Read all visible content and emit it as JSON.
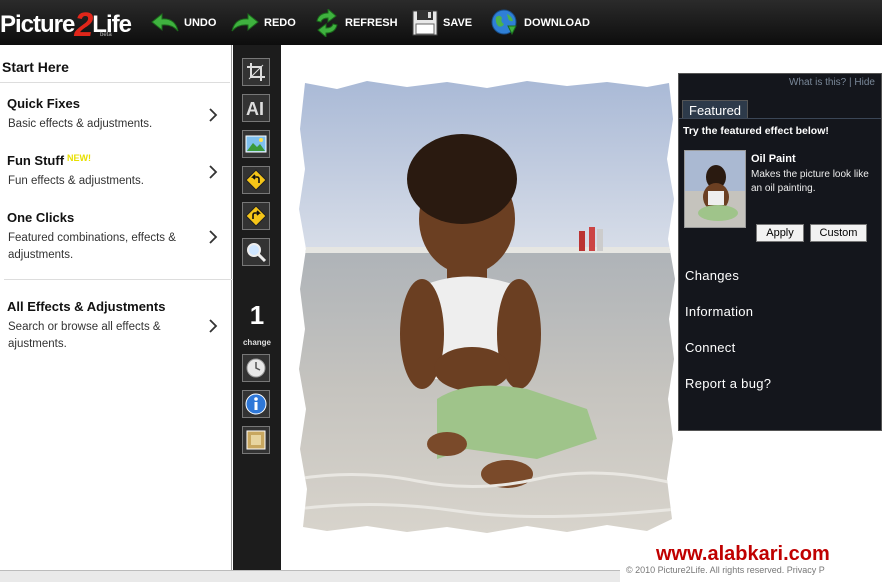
{
  "app": {
    "logo_text_a": "Picture",
    "logo_text_b": "2",
    "logo_text_c": "Life",
    "logo_beta": "beta"
  },
  "toolbar": {
    "undo": "UNDO",
    "redo": "REDO",
    "refresh": "REFRESH",
    "save": "SAVE",
    "download": "DOWNLOAD"
  },
  "sidebar": {
    "title": "Start Here",
    "items": [
      {
        "title": "Quick Fixes",
        "desc": "Basic effects & adjustments."
      },
      {
        "title": "Fun Stuff",
        "badge": "NEW!",
        "desc": "Fun effects & adjustments."
      },
      {
        "title": "One Clicks",
        "desc": "Featured combinations, effects & adjustments."
      },
      {
        "title": "All Effects & Adjustments",
        "desc": "Search or browse all effects & ajustments."
      }
    ]
  },
  "tools": {
    "icons": [
      "crop-icon",
      "text-icon",
      "image-icon",
      "rotate-left-icon",
      "rotate-right-icon",
      "zoom-icon",
      "history-clock-icon",
      "info-icon",
      "frame-icon"
    ],
    "change_count": "1",
    "change_label": "change"
  },
  "right_panel": {
    "what_is_this": "What is this?",
    "separator": "|",
    "hide": "Hide",
    "tab": "Featured",
    "try_text": "Try the featured effect below!",
    "effect_title": "Oil Paint",
    "effect_desc": "Makes the picture look like an oil painting.",
    "apply": "Apply",
    "custom": "Custom",
    "menu": [
      "Changes",
      "Information",
      "Connect",
      "Report a bug?"
    ]
  },
  "watermark": "www.alabkari.com",
  "copyright": "© 2010 Picture2Life. All rights reserved. Privacy P",
  "colors": {
    "toolbar_bg": "#111111",
    "panel_dark": "#14161c",
    "accent_red": "#e0261a",
    "watermark_red": "#c00000"
  }
}
